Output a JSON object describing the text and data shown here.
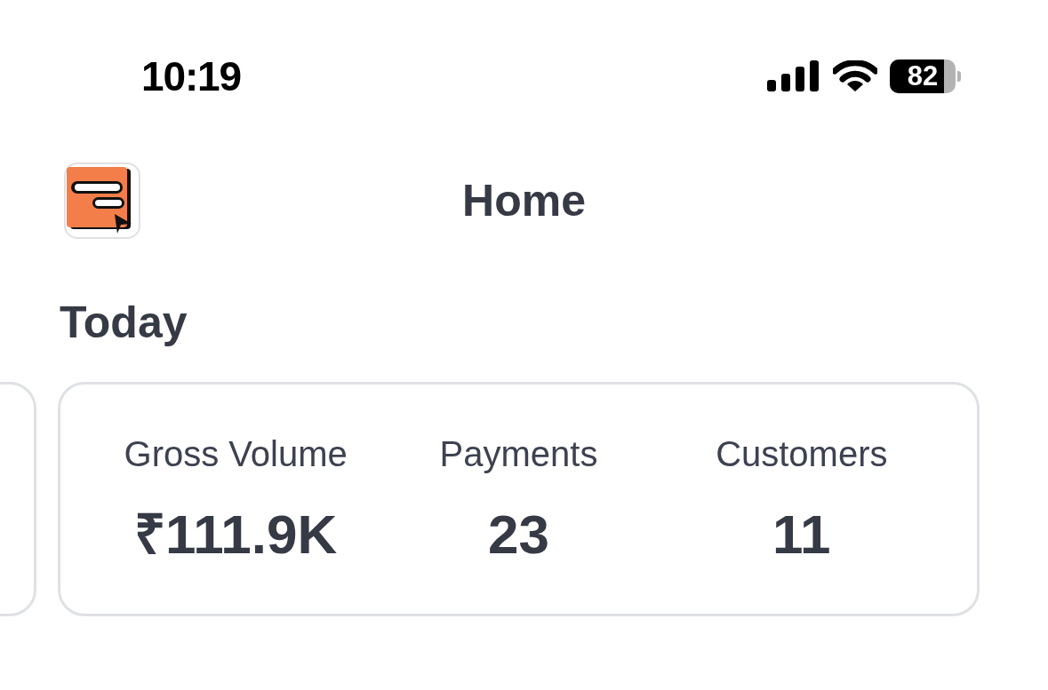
{
  "status_bar": {
    "time": "10:19",
    "battery": {
      "text": "82",
      "level": 0.82
    }
  },
  "header": {
    "title": "Home"
  },
  "section": {
    "title": "Today"
  },
  "stats": [
    {
      "label": "Gross Volume",
      "value": "₹111.9K"
    },
    {
      "label": "Payments",
      "value": "23"
    },
    {
      "label": "Customers",
      "value": "11"
    }
  ]
}
